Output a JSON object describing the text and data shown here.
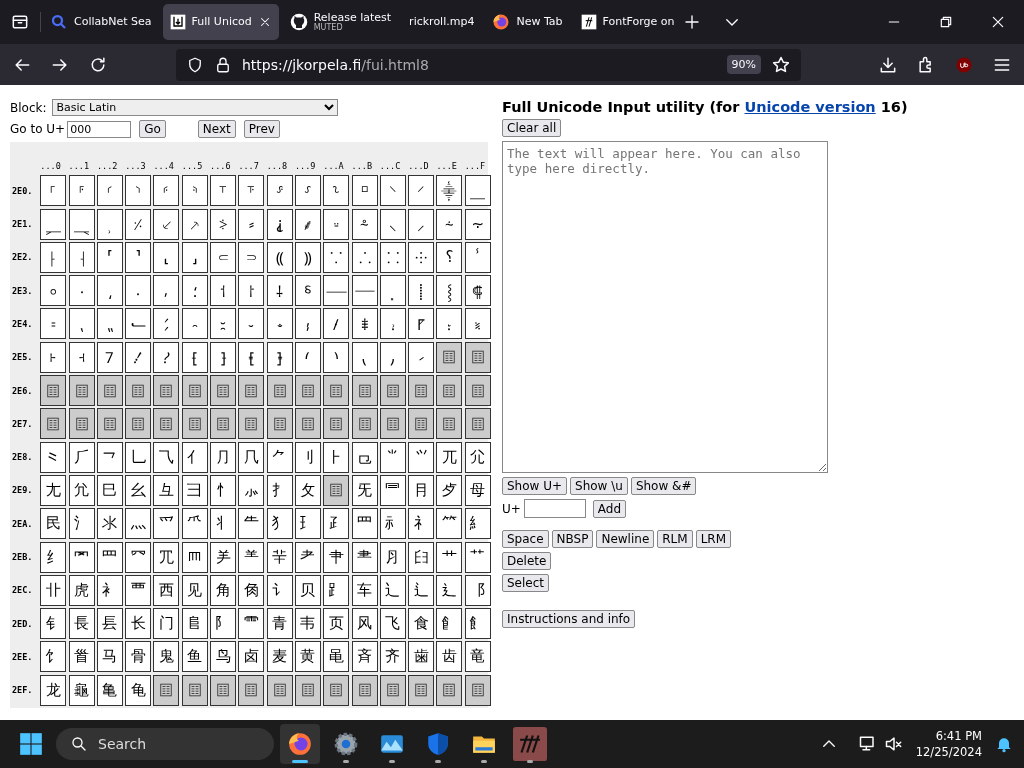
{
  "browser": {
    "tabs": [
      {
        "kind": "search",
        "title": "CollabNet Sea",
        "selected": false
      },
      {
        "kind": "unicode",
        "title": "Full Unicod",
        "selected": true
      },
      {
        "kind": "github",
        "title": "Release latest",
        "subtitle": "MUTED",
        "selected": false
      },
      {
        "kind": "plain",
        "title": "rickroll.mp4",
        "selected": false
      },
      {
        "kind": "firefox",
        "title": "New Tab",
        "selected": false
      },
      {
        "kind": "fontforge",
        "title": "FontForge on",
        "selected": false
      }
    ],
    "url_host": "https://jkorpela.fi",
    "url_path": "/fui.html8",
    "zoom": "90%"
  },
  "page": {
    "block_label": "Block:",
    "block_value": "Basic Latin",
    "goto_label": "Go to U+",
    "goto_value": "000",
    "nav_buttons": [
      "Go",
      "Next",
      "Prev"
    ],
    "column_headers": [
      "...0",
      "...1",
      "...2",
      "...3",
      "...4",
      "...5",
      "...6",
      "...7",
      "...8",
      "...9",
      "...A",
      "...B",
      "...C",
      "...D",
      "...E",
      "...F"
    ],
    "rows": [
      {
        "label": "2E0.",
        "cells": [
          "⸀",
          "⸁",
          "⸂",
          "⸃",
          "⸄",
          "⸅",
          "⸆",
          "⸇",
          "⸈",
          "⸉",
          "⸊",
          "⸋",
          "⸌",
          "⸍",
          "⸎",
          "⸏"
        ]
      },
      {
        "label": "2E1.",
        "cells": [
          "⸐",
          "⸑",
          "⸒",
          "⸓",
          "⸔",
          "⸕",
          "⸖",
          "⸗",
          "⸘",
          "⸙",
          "⸚",
          "⸛",
          "⸜",
          "⸝",
          "⸞",
          "⸟"
        ]
      },
      {
        "label": "2E2.",
        "cells": [
          "⸠",
          "⸡",
          "⸢",
          "⸣",
          "⸤",
          "⸥",
          "⸦",
          "⸧",
          "⸨",
          "⸩",
          "⸪",
          "⸫",
          "⸬",
          "⸭",
          "⸮",
          "ⸯ"
        ]
      },
      {
        "label": "2E3.",
        "cells": [
          "⸰",
          "⸱",
          "⸲",
          "⸳",
          "⸴",
          "⸵",
          "⸶",
          "⸷",
          "⸸",
          "⸹",
          "⸺",
          "⸻",
          "⸼",
          "⸽",
          "⸾",
          "⸿"
        ]
      },
      {
        "label": "2E4.",
        "cells": [
          "⹀",
          "⹁",
          "⹂",
          "⹃",
          "⹄",
          "⹅",
          "⹆",
          "⹇",
          "⹈",
          "⹉",
          "⹊",
          "⹋",
          "⹌",
          "⹍",
          "⹎",
          "⹏"
        ]
      },
      {
        "label": "2E5.",
        "cells": [
          "⹐",
          "⹑",
          "⹒",
          "⹓",
          "⹔",
          "⹕",
          "⹖",
          "⹗",
          "⹘",
          "⹙",
          "⹚",
          "⹛",
          "⹜",
          "⹝",
          null,
          null
        ]
      },
      {
        "label": "2E6.",
        "cells": [
          null,
          null,
          null,
          null,
          null,
          null,
          null,
          null,
          null,
          null,
          null,
          null,
          null,
          null,
          null,
          null
        ]
      },
      {
        "label": "2E7.",
        "cells": [
          null,
          null,
          null,
          null,
          null,
          null,
          null,
          null,
          null,
          null,
          null,
          null,
          null,
          null,
          null,
          null
        ]
      },
      {
        "label": "2E8.",
        "cells": [
          "⺀",
          "⺁",
          "⺂",
          "⺃",
          "⺄",
          "⺅",
          "⺆",
          "⺇",
          "⺈",
          "⺉",
          "⺊",
          "⺋",
          "⺌",
          "⺍",
          "⺎",
          "⺏"
        ]
      },
      {
        "label": "2E9.",
        "cells": [
          "⺐",
          "⺑",
          "⺒",
          "⺓",
          "⺔",
          "⺕",
          "⺖",
          "⺗",
          "⺘",
          "⺙",
          null,
          "⺛",
          "⺜",
          "⺝",
          "⺞",
          "⺟"
        ]
      },
      {
        "label": "2EA.",
        "cells": [
          "⺠",
          "⺡",
          "⺢",
          "⺣",
          "⺤",
          "⺥",
          "⺦",
          "⺧",
          "⺨",
          "⺩",
          "⺪",
          "⺫",
          "⺬",
          "⺭",
          "⺮",
          "⺯"
        ]
      },
      {
        "label": "2EB.",
        "cells": [
          "⺰",
          "⺱",
          "⺲",
          "⺳",
          "⺴",
          "⺵",
          "⺶",
          "⺷",
          "⺸",
          "⺹",
          "⺺",
          "⺻",
          "⺼",
          "⺽",
          "⺾",
          "⺿"
        ]
      },
      {
        "label": "2EC.",
        "cells": [
          "⻀",
          "⻁",
          "⻂",
          "⻃",
          "⻄",
          "⻅",
          "⻆",
          "⻇",
          "⻈",
          "⻉",
          "⻊",
          "⻋",
          "⻌",
          "⻍",
          "⻎",
          "⻏"
        ]
      },
      {
        "label": "2ED.",
        "cells": [
          "⻐",
          "⻑",
          "⻒",
          "⻓",
          "⻔",
          "⻕",
          "⻖",
          "⻗",
          "⻘",
          "⻙",
          "⻚",
          "⻛",
          "⻜",
          "⻝",
          "⻞",
          "⻟"
        ]
      },
      {
        "label": "2EE.",
        "cells": [
          "⻠",
          "⻡",
          "⻢",
          "⻣",
          "⻤",
          "⻥",
          "⻦",
          "⻧",
          "⻨",
          "⻩",
          "⻪",
          "⻫",
          "⻬",
          "⻭",
          "⻮",
          "⻯"
        ]
      },
      {
        "label": "2EF.",
        "cells": [
          "⻰",
          "⻱",
          "⻲",
          "⻳",
          null,
          null,
          null,
          null,
          null,
          null,
          null,
          null,
          null,
          null,
          null,
          null
        ]
      }
    ],
    "title": {
      "before": "Full Unicode Input utility (for ",
      "link": "Unicode version",
      "after": " 16)"
    },
    "clear_button": "Clear all",
    "text_placeholder": "The text will appear here. You can also type here directly.",
    "show_buttons": [
      "Show U+",
      "Show \\u",
      "Show &#"
    ],
    "add_label": "U+",
    "add_button": "Add",
    "insert_buttons": [
      "Space",
      "NBSP",
      "Newline",
      "RLM",
      "LRM"
    ],
    "delete_button": "Delete",
    "select_button": "Select",
    "info_button": "Instructions and info"
  },
  "taskbar": {
    "search_placeholder": "Search",
    "apps": [
      {
        "kind": "firefox",
        "selected": true
      },
      {
        "kind": "settings",
        "selected": false
      },
      {
        "kind": "photos",
        "selected": false
      },
      {
        "kind": "shield",
        "selected": false
      },
      {
        "kind": "folder",
        "selected": false
      },
      {
        "kind": "fontforge",
        "selected": false
      }
    ],
    "time": "6:41 PM",
    "date": "12/25/2024"
  }
}
